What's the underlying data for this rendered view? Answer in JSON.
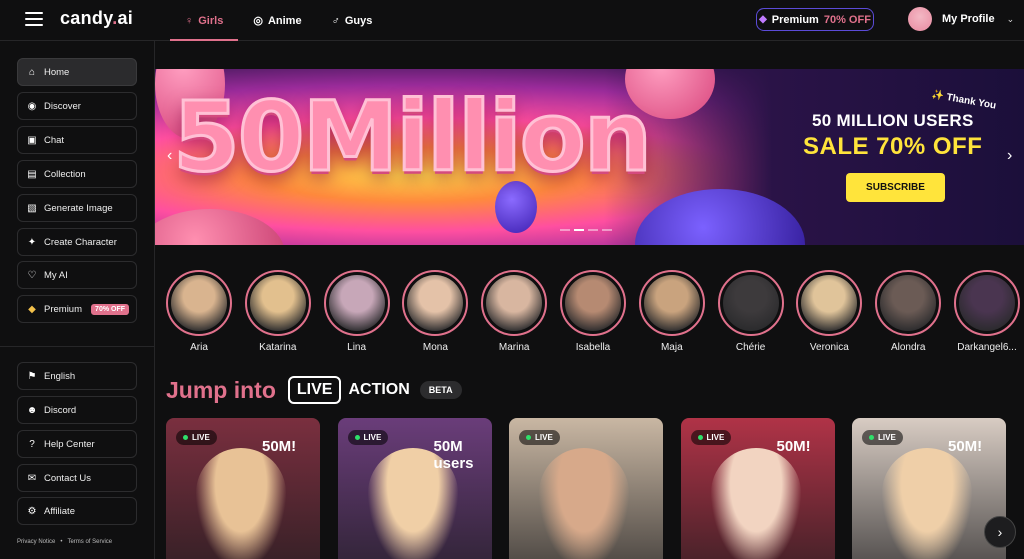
{
  "header": {
    "logo_main": "candy",
    "logo_dot": ".",
    "logo_tld": "ai",
    "tabs": [
      {
        "label": "Girls",
        "icon": "female-icon",
        "active": true
      },
      {
        "label": "Anime",
        "icon": "anime-icon",
        "active": false
      },
      {
        "label": "Guys",
        "icon": "male-icon",
        "active": false
      }
    ],
    "premium": {
      "label": "Premium",
      "discount": "70% OFF"
    },
    "profile_label": "My Profile"
  },
  "sidebar": {
    "items": [
      {
        "label": "Home",
        "icon": "home-icon"
      },
      {
        "label": "Discover",
        "icon": "compass-icon"
      },
      {
        "label": "Chat",
        "icon": "chat-icon"
      },
      {
        "label": "Collection",
        "icon": "collection-icon"
      },
      {
        "label": "Generate Image",
        "icon": "image-icon"
      },
      {
        "label": "Create Character",
        "icon": "wand-icon"
      },
      {
        "label": "My AI",
        "icon": "heart-icon"
      },
      {
        "label": "Premium",
        "icon": "diamond-icon",
        "badge": "70% OFF"
      }
    ],
    "secondary": [
      {
        "label": "English",
        "icon": "flag-icon"
      },
      {
        "label": "Discord",
        "icon": "discord-icon"
      },
      {
        "label": "Help Center",
        "icon": "help-icon"
      },
      {
        "label": "Contact Us",
        "icon": "contact-icon"
      },
      {
        "label": "Affiliate",
        "icon": "affiliate-icon"
      }
    ],
    "footer": {
      "privacy": "Privacy Notice",
      "bullet": "•",
      "terms": "Terms of Service"
    }
  },
  "banner": {
    "headline": "50Million",
    "thank_you": "Thank You",
    "line1": "50 MILLION USERS",
    "line2": "SALE 70% OFF",
    "cta": "SUBSCRIBE",
    "prev": "‹",
    "next": "›"
  },
  "stories": [
    {
      "name": "Aria",
      "color": "#d9b48f"
    },
    {
      "name": "Katarina",
      "color": "#e2c08e"
    },
    {
      "name": "Lina",
      "color": "#c7a7b8"
    },
    {
      "name": "Mona",
      "color": "#e4c2a8"
    },
    {
      "name": "Marina",
      "color": "#d8b6a0"
    },
    {
      "name": "Isabella",
      "color": "#b68a72"
    },
    {
      "name": "Maja",
      "color": "#c9a37e"
    },
    {
      "name": "Chérie",
      "color": "#3d3a3c"
    },
    {
      "name": "Veronica",
      "color": "#e0c49a"
    },
    {
      "name": "Alondra",
      "color": "#6b5b55"
    },
    {
      "name": "Darkangel6...",
      "color": "#4a3550"
    }
  ],
  "section": {
    "jump_into": "Jump into",
    "live": "LIVE",
    "action": "ACTION",
    "beta": "BETA"
  },
  "live_cards": [
    {
      "badge": "LIVE",
      "tag": "50M!",
      "bg": "#7a2f3f",
      "skin": "#e8c296"
    },
    {
      "badge": "LIVE",
      "tag": "50M users",
      "bg": "#6a3d7a",
      "skin": "#f0cfa6"
    },
    {
      "badge": "LIVE",
      "tag": "",
      "bg": "#c9b7a3",
      "skin": "#d7a98a"
    },
    {
      "badge": "LIVE",
      "tag": "50M!",
      "bg": "#b03347",
      "skin": "#f2d4c1"
    },
    {
      "badge": "LIVE",
      "tag": "50M!",
      "bg": "#d8ccc3",
      "skin": "#efcfa8"
    }
  ],
  "next_arrow": "›"
}
